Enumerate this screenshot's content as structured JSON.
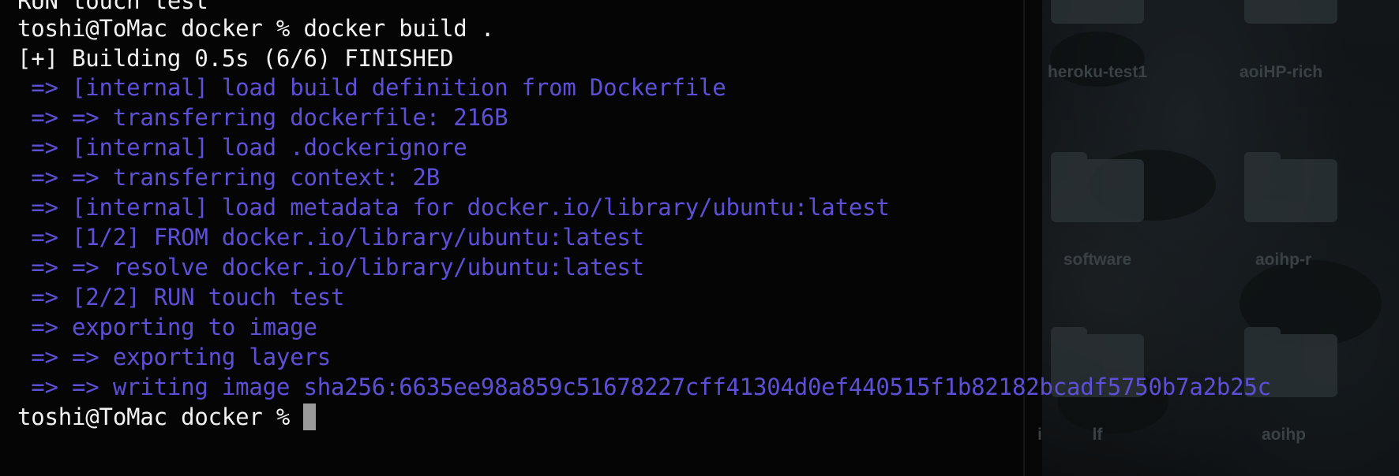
{
  "terminal": {
    "lines": [
      {
        "text": "RUN touch test",
        "kind": "prompt"
      },
      {
        "text": "toshi@ToMac docker % docker build .",
        "kind": "prompt"
      },
      {
        "text": "[+] Building 0.5s (6/6) FINISHED",
        "kind": "prompt"
      },
      {
        "text": " => [internal] load build definition from Dockerfile",
        "kind": "out"
      },
      {
        "text": " => => transferring dockerfile: 216B",
        "kind": "out"
      },
      {
        "text": " => [internal] load .dockerignore",
        "kind": "out"
      },
      {
        "text": " => => transferring context: 2B",
        "kind": "out"
      },
      {
        "text": " => [internal] load metadata for docker.io/library/ubuntu:latest",
        "kind": "out"
      },
      {
        "text": " => [1/2] FROM docker.io/library/ubuntu:latest",
        "kind": "out"
      },
      {
        "text": " => => resolve docker.io/library/ubuntu:latest",
        "kind": "out"
      },
      {
        "text": " => [2/2] RUN touch test",
        "kind": "out"
      },
      {
        "text": " => exporting to image",
        "kind": "out"
      },
      {
        "text": " => => exporting layers",
        "kind": "out"
      }
    ],
    "last_output": " => => writing image sha256:6635ee98a859c51678227cff41304d0ef440515f1b82182bcadf5750b7a2b25c",
    "current_prompt": "toshi@ToMac docker % ",
    "colors": {
      "prompt_text": "#f2f2f2",
      "output_text": "#5d4fd6",
      "background": "#050505",
      "cursor": "#9a9a9a"
    }
  },
  "desktop": {
    "icons": [
      {
        "label": "heroku-test1",
        "icon": "folder-icon"
      },
      {
        "label": "aoiHP-rich",
        "icon": "folder-icon"
      },
      {
        "label": "software",
        "icon": "folder-icon"
      },
      {
        "label": "aoihp-r",
        "icon": "folder-icon"
      },
      {
        "label": "lf",
        "icon": "folder-icon"
      },
      {
        "label": "aoihp",
        "icon": "folder-icon"
      },
      {
        "label": "i",
        "icon": "folder-icon"
      }
    ]
  }
}
